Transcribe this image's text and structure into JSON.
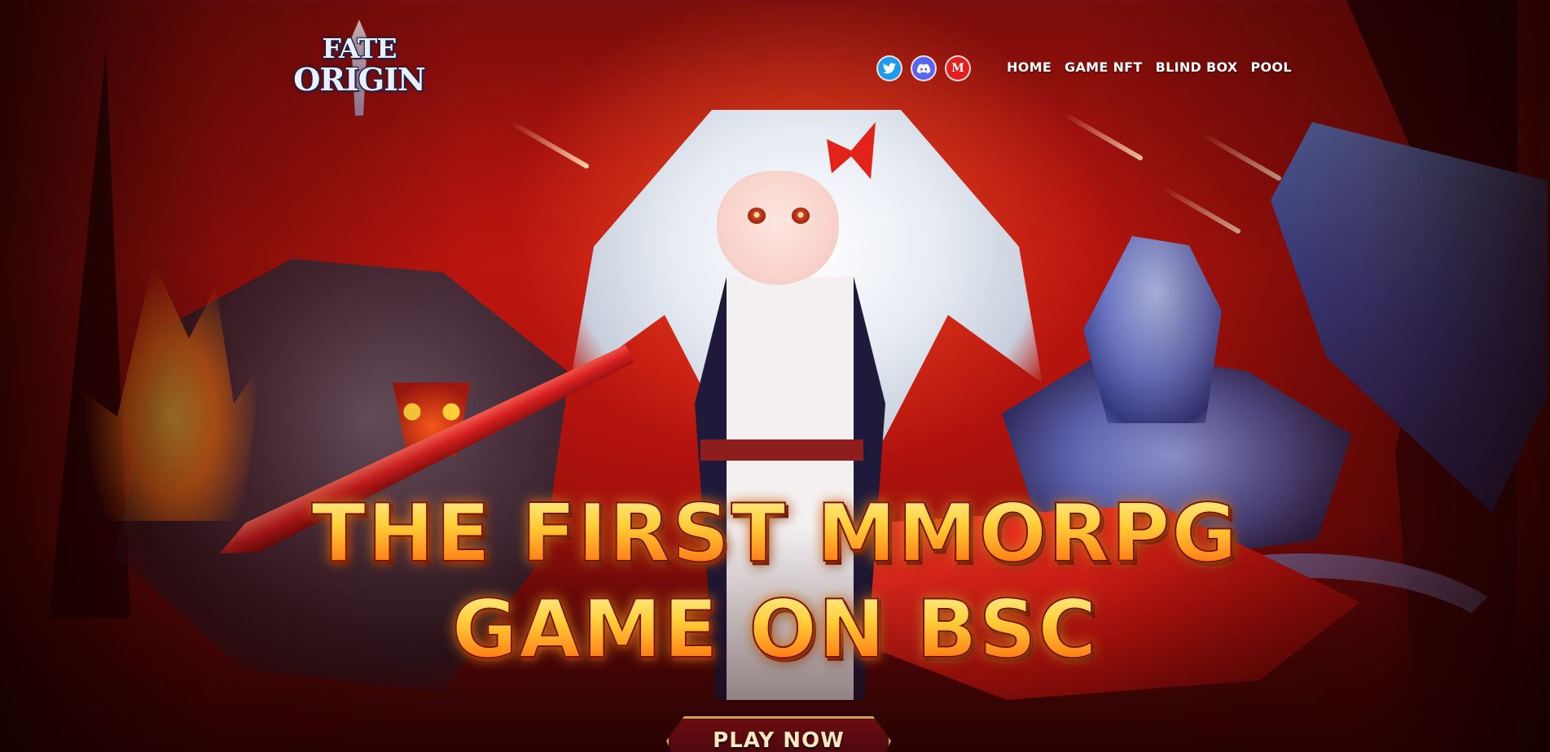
{
  "logo": {
    "line1": "FATE",
    "line2": "ORIGIN"
  },
  "socials": [
    {
      "name": "twitter",
      "glyph": "🐦",
      "icon": "twitter-icon",
      "color": "#1d9bf0"
    },
    {
      "name": "discord",
      "glyph": "◙",
      "icon": "discord-icon",
      "color": "#5865f2"
    },
    {
      "name": "medium",
      "glyph": "M",
      "icon": "medium-icon",
      "color": "#e41e1e"
    }
  ],
  "nav": {
    "home": "HOME",
    "game_nft": "GAME NFT",
    "blind_box": "BLIND BOX",
    "pool": "POOL"
  },
  "hero": {
    "headline_line1": "THE FIRST MMORPG",
    "headline_line2": "GAME ON BSC",
    "cta_label": "PLAY NOW"
  },
  "colors": {
    "background_red": "#b3140e",
    "headline_gold": "#ffcf3a",
    "cta_border": "#c6a257"
  }
}
